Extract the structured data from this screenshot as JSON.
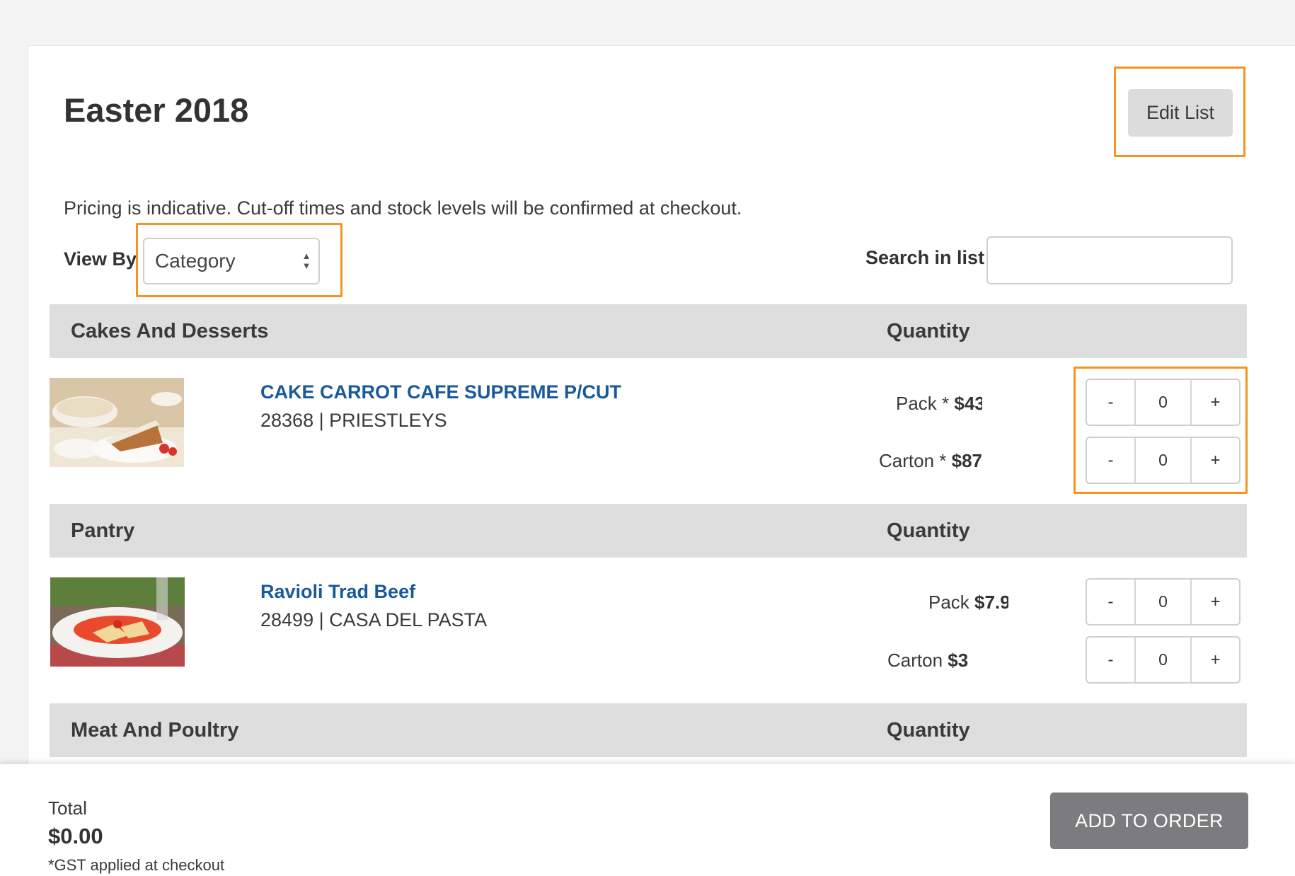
{
  "page": {
    "title": "Easter 2018",
    "edit_button": "Edit List",
    "disclaimer": "Pricing is indicative. Cut-off times and stock levels will be confirmed at checkout.",
    "view_by_label": "View By",
    "view_by_value": "Category",
    "search_label": "Search in list",
    "search_value": ""
  },
  "sections": [
    {
      "name": "Cakes And Desserts",
      "quantity_label": "Quantity",
      "products": [
        {
          "name": "CAKE CARROT CAFE SUPREME P/CUT",
          "meta": "28368 | PRIESTLEYS",
          "options": [
            {
              "unit": "Pack",
              "marker": "*",
              "price": "$43",
              "qty": "0"
            },
            {
              "unit": "Carton",
              "marker": "*",
              "price": "$87",
              "qty": "0"
            }
          ]
        }
      ]
    },
    {
      "name": "Pantry",
      "quantity_label": "Quantity",
      "products": [
        {
          "name": "Ravioli Trad Beef",
          "meta": "28499 | CASA DEL PASTA",
          "options": [
            {
              "unit": "Pack",
              "marker": "",
              "price": "$7.9",
              "qty": "0"
            },
            {
              "unit": "Carton",
              "marker": "",
              "price": "$3",
              "qty": "0"
            }
          ]
        }
      ]
    },
    {
      "name": "Meat And Poultry",
      "quantity_label": "Quantity",
      "products": []
    }
  ],
  "stepper": {
    "minus": "-",
    "plus": "+"
  },
  "footer": {
    "total_label": "Total",
    "total_value": "$0.00",
    "gst_note": "*GST applied at checkout",
    "add_button": "ADD TO ORDER"
  },
  "colors": {
    "highlight": "#f7931e",
    "link": "#1a5a9c",
    "section_bg": "#dedede",
    "primary_button": "#7c7c7e"
  }
}
